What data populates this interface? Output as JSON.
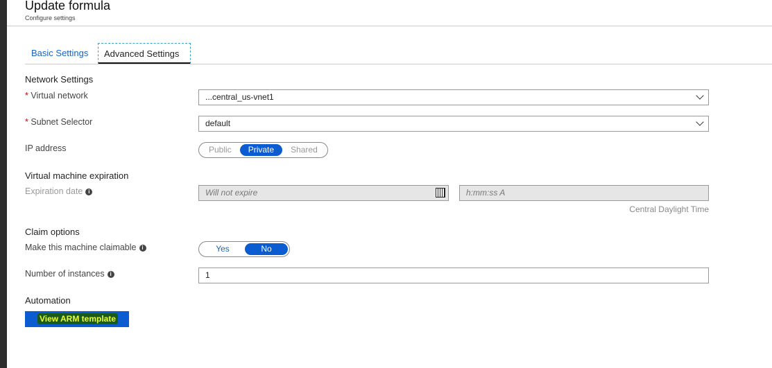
{
  "header": {
    "title": "Update formula",
    "subtitle": "Configure settings"
  },
  "tabs": [
    {
      "label": "Basic Settings",
      "active": false
    },
    {
      "label": "Advanced Settings",
      "active": true
    }
  ],
  "network": {
    "heading": "Network Settings",
    "virtual_network": {
      "label": "Virtual network",
      "value": "...central_us-vnet1"
    },
    "subnet": {
      "label": "Subnet Selector",
      "value": "default"
    },
    "ip": {
      "label": "IP address",
      "options": [
        "Public",
        "Private",
        "Shared"
      ],
      "selected": "Private"
    }
  },
  "expiration": {
    "heading": "Virtual machine expiration",
    "label": "Expiration date",
    "date_placeholder": "Will not expire",
    "time_placeholder": "h:mm:ss A",
    "timezone": "Central Daylight Time"
  },
  "claim": {
    "heading": "Claim options",
    "claimable_label": "Make this machine claimable",
    "options": [
      "Yes",
      "No"
    ],
    "selected": "No",
    "instances_label": "Number of instances",
    "instances_value": "1"
  },
  "automation": {
    "heading": "Automation",
    "arm_button": "View ARM template"
  },
  "required_mark": "*",
  "info_glyph": "i"
}
